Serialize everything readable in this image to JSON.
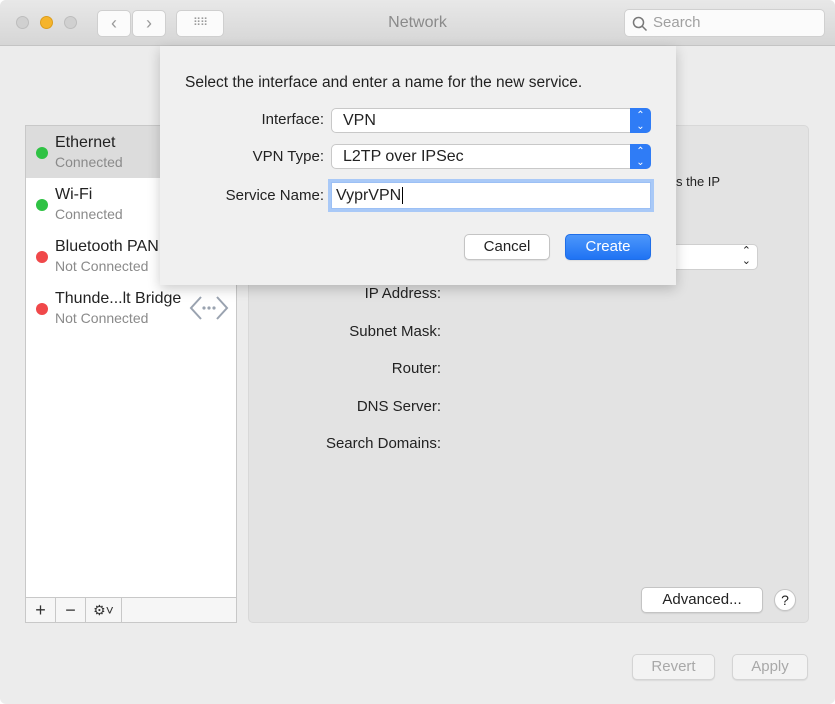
{
  "window": {
    "title": "Network",
    "search_placeholder": "Search"
  },
  "services": [
    {
      "name": "Ethernet",
      "status": "Connected",
      "color": "#2fc244",
      "selected": true
    },
    {
      "name": "Wi-Fi",
      "status": "Connected",
      "color": "#2fc244"
    },
    {
      "name": "Bluetooth PAN",
      "status": "Not Connected",
      "color": "#f0484a"
    },
    {
      "name": "Thunde...lt Bridge",
      "status": "Not Connected",
      "color": "#f0484a"
    }
  ],
  "list_toolbar": {
    "add": "+",
    "remove": "−",
    "action": "⚙˅"
  },
  "detail": {
    "partial_text": "s the IP",
    "labels": [
      "IP Address:",
      "Subnet Mask:",
      "Router:",
      "DNS Server:",
      "Search Domains:"
    ],
    "advanced": "Advanced...",
    "help": "?"
  },
  "footer": {
    "revert": "Revert",
    "apply": "Apply"
  },
  "sheet": {
    "prompt": "Select the interface and enter a name for the new service.",
    "interface_label": "Interface:",
    "interface_value": "VPN",
    "vpn_type_label": "VPN Type:",
    "vpn_type_value": "L2TP over IPSec",
    "service_name_label": "Service Name:",
    "service_name_value": "VyprVPN",
    "cancel": "Cancel",
    "create": "Create"
  }
}
